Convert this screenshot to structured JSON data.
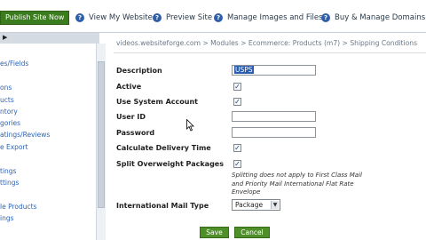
{
  "topbar": {
    "publish_label": "Publish Site Now",
    "nav": [
      {
        "label": "View My Website",
        "icon": "help-icon"
      },
      {
        "label": "Preview Site",
        "icon": "help-icon"
      },
      {
        "label": "Manage Images and Files",
        "icon": "help-icon"
      },
      {
        "label": "Buy & Manage Domains",
        "icon": "help-icon"
      }
    ]
  },
  "sidebar": {
    "items": [
      "es/Fields",
      "ons",
      "ucts",
      "ntory",
      "gories",
      "atings/Reviews",
      "e Export",
      "tings",
      "ttings",
      "le Products",
      "ings"
    ]
  },
  "breadcrumb": "videos.websiteforge.com > Modules > Ecommerce: Products (m7) > Shipping Conditions",
  "form": {
    "description_label": "Description",
    "description_value": "USPS",
    "active_label": "Active",
    "use_system_account_label": "Use System Account",
    "user_id_label": "User ID",
    "password_label": "Password",
    "calculate_delivery_label": "Calculate Delivery Time",
    "split_overweight_label": "Split Overweight Packages",
    "split_note": "Splitting does not apply to First Class Mail and Priority Mail International Flat Rate Envelope",
    "intl_mail_type_label": "International Mail Type",
    "intl_mail_type_value": "Package"
  },
  "buttons": {
    "save_label": "Save",
    "cancel_label": "Cancel"
  },
  "colors": {
    "accent_green": "#3b7d1e",
    "link_blue": "#2d64b7",
    "nav_blue": "#2f5fa8"
  }
}
